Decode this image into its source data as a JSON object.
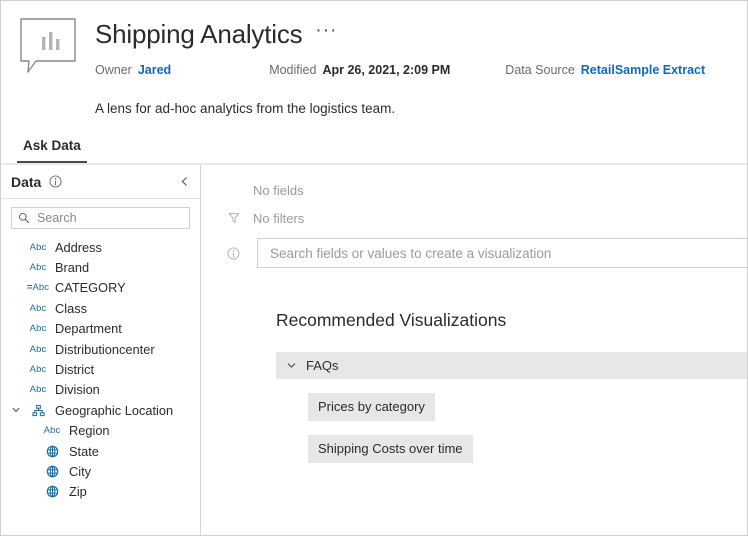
{
  "header": {
    "icon_name": "ask-data-lens-icon",
    "title": "Shipping Analytics",
    "overflow_menu": "···",
    "owner_label": "Owner",
    "owner_value": "Jared",
    "modified_label": "Modified",
    "modified_value": "Apr 26, 2021, 2:09 PM",
    "datasource_label": "Data Source",
    "datasource_value": "RetailSample Extract",
    "description": "A lens for ad-hoc analytics from the logistics team."
  },
  "tabs": [
    {
      "label": "Ask Data",
      "active": true
    }
  ],
  "sidebar": {
    "title": "Data",
    "info_tooltip_icon": "info-icon",
    "collapse_icon": "chevron-left-icon",
    "search": {
      "placeholder": "Search",
      "value": "",
      "icon": "search-icon"
    },
    "fields": [
      {
        "label": "Address",
        "type": "abc",
        "indent": 0
      },
      {
        "label": "Brand",
        "type": "abc",
        "indent": 0
      },
      {
        "label": "CATEGORY",
        "type": "calc-abc",
        "indent": 0
      },
      {
        "label": "Class",
        "type": "abc",
        "indent": 0
      },
      {
        "label": "Department",
        "type": "abc",
        "indent": 0
      },
      {
        "label": "Distributioncenter",
        "type": "abc",
        "indent": 0
      },
      {
        "label": "District",
        "type": "abc",
        "indent": 0
      },
      {
        "label": "Division",
        "type": "abc",
        "indent": 0
      },
      {
        "label": "Geographic Location",
        "type": "hierarchy",
        "indent": 0,
        "expanded": true
      },
      {
        "label": "Region",
        "type": "abc",
        "indent": 1
      },
      {
        "label": "State",
        "type": "geo",
        "indent": 1
      },
      {
        "label": "City",
        "type": "geo",
        "indent": 1
      },
      {
        "label": "Zip",
        "type": "geo",
        "indent": 1
      }
    ]
  },
  "main": {
    "no_fields_text": "No fields",
    "no_filters_text": "No filters",
    "filter_icon": "filter-icon",
    "query_info_icon": "info-icon",
    "query_placeholder": "Search fields or values to create a visualization",
    "query_value": "",
    "recommended_title": "Recommended Visualizations",
    "groups": [
      {
        "label": "FAQs",
        "expanded": true,
        "chevron_icon": "chevron-down-icon",
        "items": [
          {
            "label": "Prices by category"
          },
          {
            "label": "Shipping Costs over time"
          }
        ]
      }
    ]
  },
  "colors": {
    "link": "#1068bf",
    "field_icon_blue": "#1f6ea5",
    "chip_bg": "#e7e7e7",
    "tab_underline": "#4a4a4a",
    "muted_text": "#9a9aa4"
  }
}
